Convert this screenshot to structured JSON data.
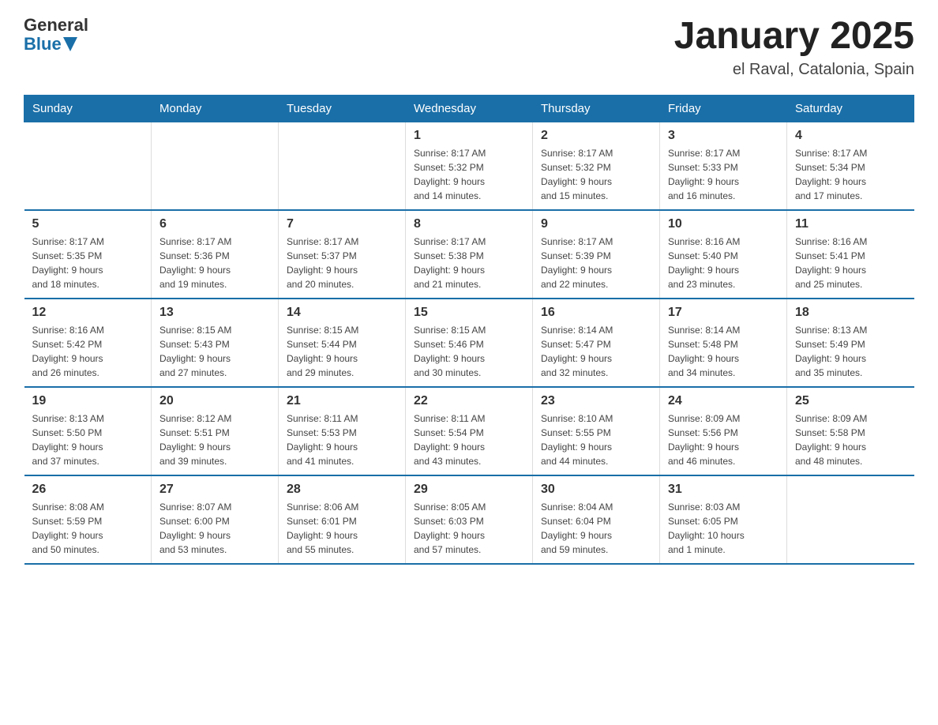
{
  "header": {
    "logo_general": "General",
    "logo_blue": "Blue",
    "month_title": "January 2025",
    "subtitle": "el Raval, Catalonia, Spain"
  },
  "days_of_week": [
    "Sunday",
    "Monday",
    "Tuesday",
    "Wednesday",
    "Thursday",
    "Friday",
    "Saturday"
  ],
  "weeks": [
    [
      {
        "day": "",
        "info": ""
      },
      {
        "day": "",
        "info": ""
      },
      {
        "day": "",
        "info": ""
      },
      {
        "day": "1",
        "info": "Sunrise: 8:17 AM\nSunset: 5:32 PM\nDaylight: 9 hours\nand 14 minutes."
      },
      {
        "day": "2",
        "info": "Sunrise: 8:17 AM\nSunset: 5:32 PM\nDaylight: 9 hours\nand 15 minutes."
      },
      {
        "day": "3",
        "info": "Sunrise: 8:17 AM\nSunset: 5:33 PM\nDaylight: 9 hours\nand 16 minutes."
      },
      {
        "day": "4",
        "info": "Sunrise: 8:17 AM\nSunset: 5:34 PM\nDaylight: 9 hours\nand 17 minutes."
      }
    ],
    [
      {
        "day": "5",
        "info": "Sunrise: 8:17 AM\nSunset: 5:35 PM\nDaylight: 9 hours\nand 18 minutes."
      },
      {
        "day": "6",
        "info": "Sunrise: 8:17 AM\nSunset: 5:36 PM\nDaylight: 9 hours\nand 19 minutes."
      },
      {
        "day": "7",
        "info": "Sunrise: 8:17 AM\nSunset: 5:37 PM\nDaylight: 9 hours\nand 20 minutes."
      },
      {
        "day": "8",
        "info": "Sunrise: 8:17 AM\nSunset: 5:38 PM\nDaylight: 9 hours\nand 21 minutes."
      },
      {
        "day": "9",
        "info": "Sunrise: 8:17 AM\nSunset: 5:39 PM\nDaylight: 9 hours\nand 22 minutes."
      },
      {
        "day": "10",
        "info": "Sunrise: 8:16 AM\nSunset: 5:40 PM\nDaylight: 9 hours\nand 23 minutes."
      },
      {
        "day": "11",
        "info": "Sunrise: 8:16 AM\nSunset: 5:41 PM\nDaylight: 9 hours\nand 25 minutes."
      }
    ],
    [
      {
        "day": "12",
        "info": "Sunrise: 8:16 AM\nSunset: 5:42 PM\nDaylight: 9 hours\nand 26 minutes."
      },
      {
        "day": "13",
        "info": "Sunrise: 8:15 AM\nSunset: 5:43 PM\nDaylight: 9 hours\nand 27 minutes."
      },
      {
        "day": "14",
        "info": "Sunrise: 8:15 AM\nSunset: 5:44 PM\nDaylight: 9 hours\nand 29 minutes."
      },
      {
        "day": "15",
        "info": "Sunrise: 8:15 AM\nSunset: 5:46 PM\nDaylight: 9 hours\nand 30 minutes."
      },
      {
        "day": "16",
        "info": "Sunrise: 8:14 AM\nSunset: 5:47 PM\nDaylight: 9 hours\nand 32 minutes."
      },
      {
        "day": "17",
        "info": "Sunrise: 8:14 AM\nSunset: 5:48 PM\nDaylight: 9 hours\nand 34 minutes."
      },
      {
        "day": "18",
        "info": "Sunrise: 8:13 AM\nSunset: 5:49 PM\nDaylight: 9 hours\nand 35 minutes."
      }
    ],
    [
      {
        "day": "19",
        "info": "Sunrise: 8:13 AM\nSunset: 5:50 PM\nDaylight: 9 hours\nand 37 minutes."
      },
      {
        "day": "20",
        "info": "Sunrise: 8:12 AM\nSunset: 5:51 PM\nDaylight: 9 hours\nand 39 minutes."
      },
      {
        "day": "21",
        "info": "Sunrise: 8:11 AM\nSunset: 5:53 PM\nDaylight: 9 hours\nand 41 minutes."
      },
      {
        "day": "22",
        "info": "Sunrise: 8:11 AM\nSunset: 5:54 PM\nDaylight: 9 hours\nand 43 minutes."
      },
      {
        "day": "23",
        "info": "Sunrise: 8:10 AM\nSunset: 5:55 PM\nDaylight: 9 hours\nand 44 minutes."
      },
      {
        "day": "24",
        "info": "Sunrise: 8:09 AM\nSunset: 5:56 PM\nDaylight: 9 hours\nand 46 minutes."
      },
      {
        "day": "25",
        "info": "Sunrise: 8:09 AM\nSunset: 5:58 PM\nDaylight: 9 hours\nand 48 minutes."
      }
    ],
    [
      {
        "day": "26",
        "info": "Sunrise: 8:08 AM\nSunset: 5:59 PM\nDaylight: 9 hours\nand 50 minutes."
      },
      {
        "day": "27",
        "info": "Sunrise: 8:07 AM\nSunset: 6:00 PM\nDaylight: 9 hours\nand 53 minutes."
      },
      {
        "day": "28",
        "info": "Sunrise: 8:06 AM\nSunset: 6:01 PM\nDaylight: 9 hours\nand 55 minutes."
      },
      {
        "day": "29",
        "info": "Sunrise: 8:05 AM\nSunset: 6:03 PM\nDaylight: 9 hours\nand 57 minutes."
      },
      {
        "day": "30",
        "info": "Sunrise: 8:04 AM\nSunset: 6:04 PM\nDaylight: 9 hours\nand 59 minutes."
      },
      {
        "day": "31",
        "info": "Sunrise: 8:03 AM\nSunset: 6:05 PM\nDaylight: 10 hours\nand 1 minute."
      },
      {
        "day": "",
        "info": ""
      }
    ]
  ]
}
